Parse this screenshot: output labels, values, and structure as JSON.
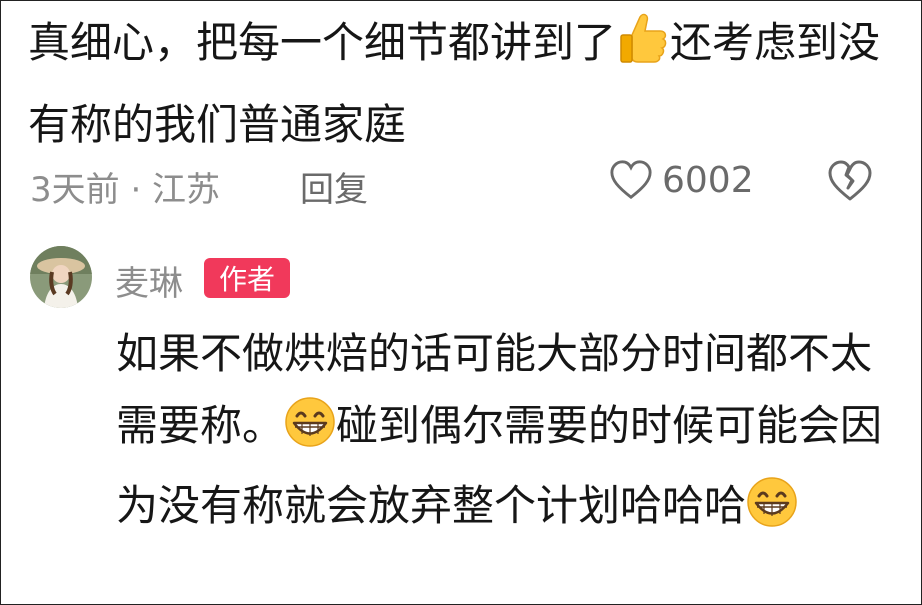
{
  "comment": {
    "text_before_emoji": "真细心，把每一个细节都讲到了",
    "emoji": "thumbs-up",
    "text_after_emoji": "还考虑到没有称的我们普通家庭",
    "date_location": "3天前 · 江苏",
    "reply_label": "回复",
    "like_count": "6002"
  },
  "reply": {
    "author_name": "麦琳",
    "author_badge": "作者",
    "text_part1": "如果不做烘焙的话可能大部分时间都不太需要称。",
    "emoji": "grinning-face",
    "text_part2": "碰到偶尔需要的时候可能会因为没有称就会放弃整个计划哈哈哈"
  },
  "colors": {
    "badge": "#f1395b",
    "meta_text": "#8d8d8d",
    "emoji_yellow": "#ffc83d"
  }
}
